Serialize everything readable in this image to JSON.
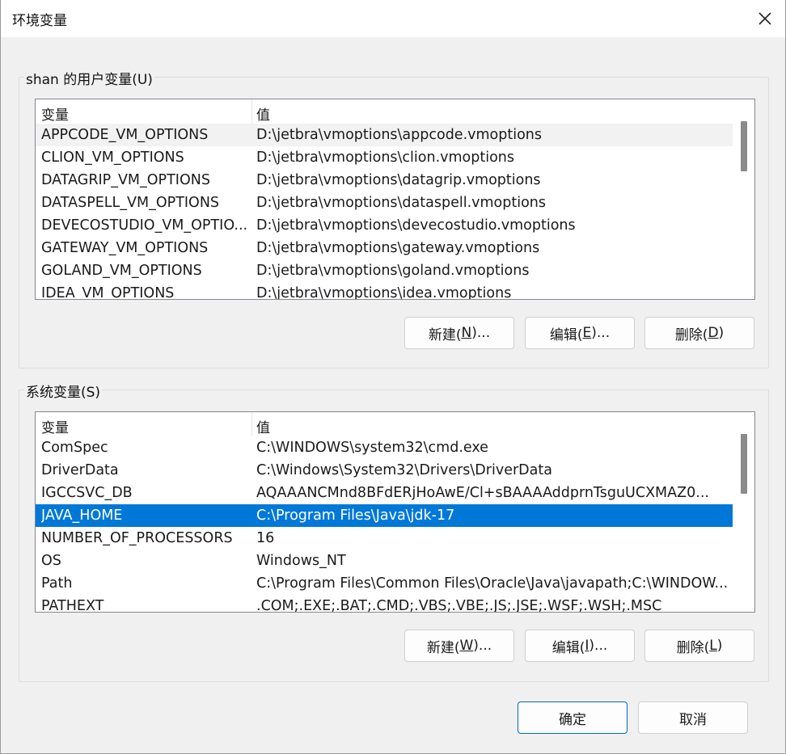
{
  "window": {
    "title": "环境变量"
  },
  "user_vars": {
    "group_label": "shan 的用户变量(U)",
    "col_name": "变量",
    "col_value": "值",
    "rows": [
      {
        "name": "APPCODE_VM_OPTIONS",
        "value": "D:\\jetbra\\vmoptions\\appcode.vmoptions"
      },
      {
        "name": "CLION_VM_OPTIONS",
        "value": "D:\\jetbra\\vmoptions\\clion.vmoptions"
      },
      {
        "name": "DATAGRIP_VM_OPTIONS",
        "value": "D:\\jetbra\\vmoptions\\datagrip.vmoptions"
      },
      {
        "name": "DATASPELL_VM_OPTIONS",
        "value": "D:\\jetbra\\vmoptions\\dataspell.vmoptions"
      },
      {
        "name": "DEVECOSTUDIO_VM_OPTIO...",
        "value": "D:\\jetbra\\vmoptions\\devecostudio.vmoptions"
      },
      {
        "name": "GATEWAY_VM_OPTIONS",
        "value": "D:\\jetbra\\vmoptions\\gateway.vmoptions"
      },
      {
        "name": "GOLAND_VM_OPTIONS",
        "value": "D:\\jetbra\\vmoptions\\goland.vmoptions"
      },
      {
        "name": "IDEA_VM_OPTIONS",
        "value": "D:\\jetbra\\vmoptions\\idea.vmoptions"
      }
    ],
    "new_label": "新建(N)...",
    "edit_label": "编辑(E)...",
    "delete_label": "删除(D)"
  },
  "system_vars": {
    "group_label": "系统变量(S)",
    "col_name": "变量",
    "col_value": "值",
    "rows": [
      {
        "name": "ComSpec",
        "value": "C:\\WINDOWS\\system32\\cmd.exe"
      },
      {
        "name": "DriverData",
        "value": "C:\\Windows\\System32\\Drivers\\DriverData"
      },
      {
        "name": "IGCCSVC_DB",
        "value": "AQAAANCMnd8BFdERjHoAwE/Cl+sBAAAAddprnTsguUCXMAZ0..."
      },
      {
        "name": "JAVA_HOME",
        "value": "C:\\Program Files\\Java\\jdk-17"
      },
      {
        "name": "NUMBER_OF_PROCESSORS",
        "value": "16"
      },
      {
        "name": "OS",
        "value": "Windows_NT"
      },
      {
        "name": "Path",
        "value": "C:\\Program Files\\Common Files\\Oracle\\Java\\javapath;C:\\WINDOW..."
      },
      {
        "name": "PATHEXT",
        "value": ".COM;.EXE;.BAT;.CMD;.VBS;.VBE;.JS;.JSE;.WSF;.WSH;.MSC"
      }
    ],
    "new_label": "新建(W)...",
    "edit_label": "编辑(I)...",
    "delete_label": "删除(L)"
  },
  "footer": {
    "ok_label": "确定",
    "cancel_label": "取消"
  },
  "colors": {
    "selection": "#0078d7",
    "hover_row": "#f2f2f2",
    "dialog_bg": "#f0f0f0",
    "primary_border": "#0067c0"
  },
  "icons": {
    "close": "close-icon"
  }
}
